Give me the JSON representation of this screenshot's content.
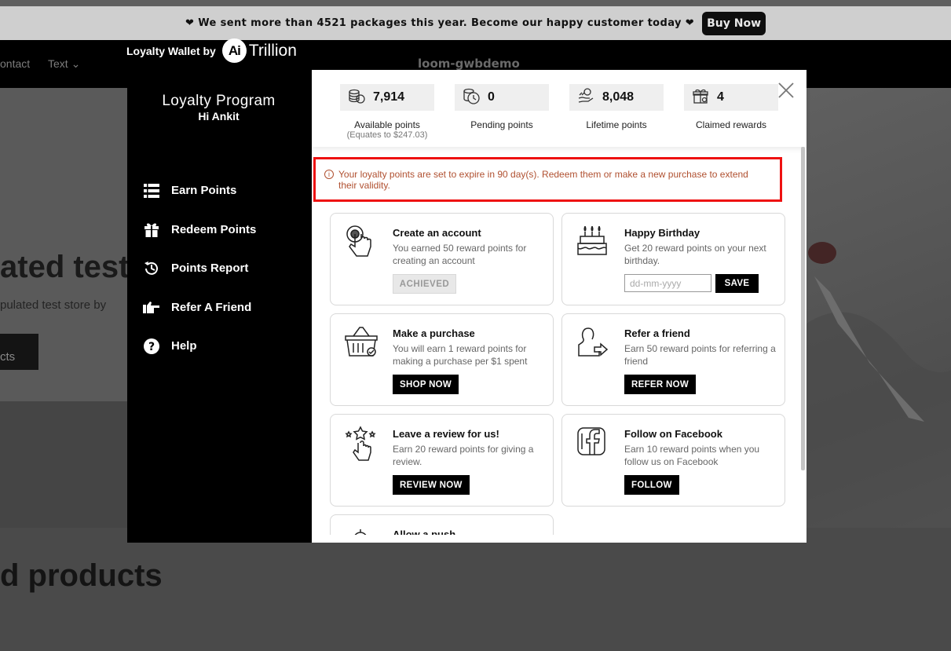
{
  "announcement": {
    "text": "❤ We sent more than 4521 packages this year. Become our happy customer today ❤",
    "button": "Buy Now"
  },
  "store": {
    "nav_contact": "ontact",
    "nav_text": "Text ⌄",
    "name": "loom-gwbdemo",
    "hero_title": "ated test",
    "hero_subtitle": "pulated test store by",
    "hero_button": "cts",
    "featured_heading": "d products"
  },
  "wallet": {
    "brand_prefix": "Loyalty Wallet by",
    "logo_ai": "Ai",
    "logo_name": "Trillion"
  },
  "sidebar": {
    "title": "Loyalty Program",
    "greeting": "Hi Ankit",
    "items": [
      {
        "label": "Earn Points",
        "icon": "list-icon"
      },
      {
        "label": "Redeem Points",
        "icon": "gift-icon"
      },
      {
        "label": "Points Report",
        "icon": "history-icon"
      },
      {
        "label": "Refer A Friend",
        "icon": "pointing-hand-icon"
      },
      {
        "label": "Help",
        "icon": "help-icon"
      }
    ]
  },
  "stats": [
    {
      "value": "7,914",
      "label": "Available points",
      "sub": "(Equates to $247.03)",
      "icon": "coins-stack-icon"
    },
    {
      "value": "0",
      "label": "Pending points",
      "icon": "coins-clock-icon"
    },
    {
      "value": "8,048",
      "label": "Lifetime points",
      "icon": "hand-coins-icon"
    },
    {
      "value": "4",
      "label": "Claimed rewards",
      "icon": "gift-box-icon"
    }
  ],
  "alert": {
    "icon": "ⓘ",
    "text": "Your loyalty points are set to expire in 90 day(s). Redeem them or make a new purchase to extend their validity."
  },
  "cards": [
    {
      "title": "Create an account",
      "desc": "You earned 50 reward points for creating an account",
      "badge": "ACHIEVED",
      "icon": "tap-finger-icon"
    },
    {
      "title": "Happy Birthday",
      "desc": "Get 20 reward points on your next birthday.",
      "placeholder": "dd-mm-yyyy",
      "button": "SAVE",
      "icon": "birthday-cake-icon"
    },
    {
      "title": "Make a purchase",
      "desc": "You will earn 1 reward points for making a purchase per $1 spent",
      "button": "SHOP NOW",
      "icon": "shopping-basket-icon"
    },
    {
      "title": "Refer a friend",
      "desc": "Earn 50 reward points for referring a friend",
      "button": "REFER NOW",
      "icon": "refer-person-icon"
    },
    {
      "title": "Leave a review for us!",
      "desc": "Earn 20 reward points for giving a review.",
      "button": "REVIEW NOW",
      "icon": "review-stars-icon"
    },
    {
      "title": "Follow on Facebook",
      "desc": "Earn 10 reward points when you follow us on Facebook",
      "button": "FOLLOW",
      "icon": "facebook-icon"
    },
    {
      "title": "Allow a push",
      "icon": "bell-icon"
    }
  ],
  "colors": {
    "alert_border": "#ee1111",
    "alert_text": "#b05030",
    "sidebar_bg": "#000000"
  }
}
